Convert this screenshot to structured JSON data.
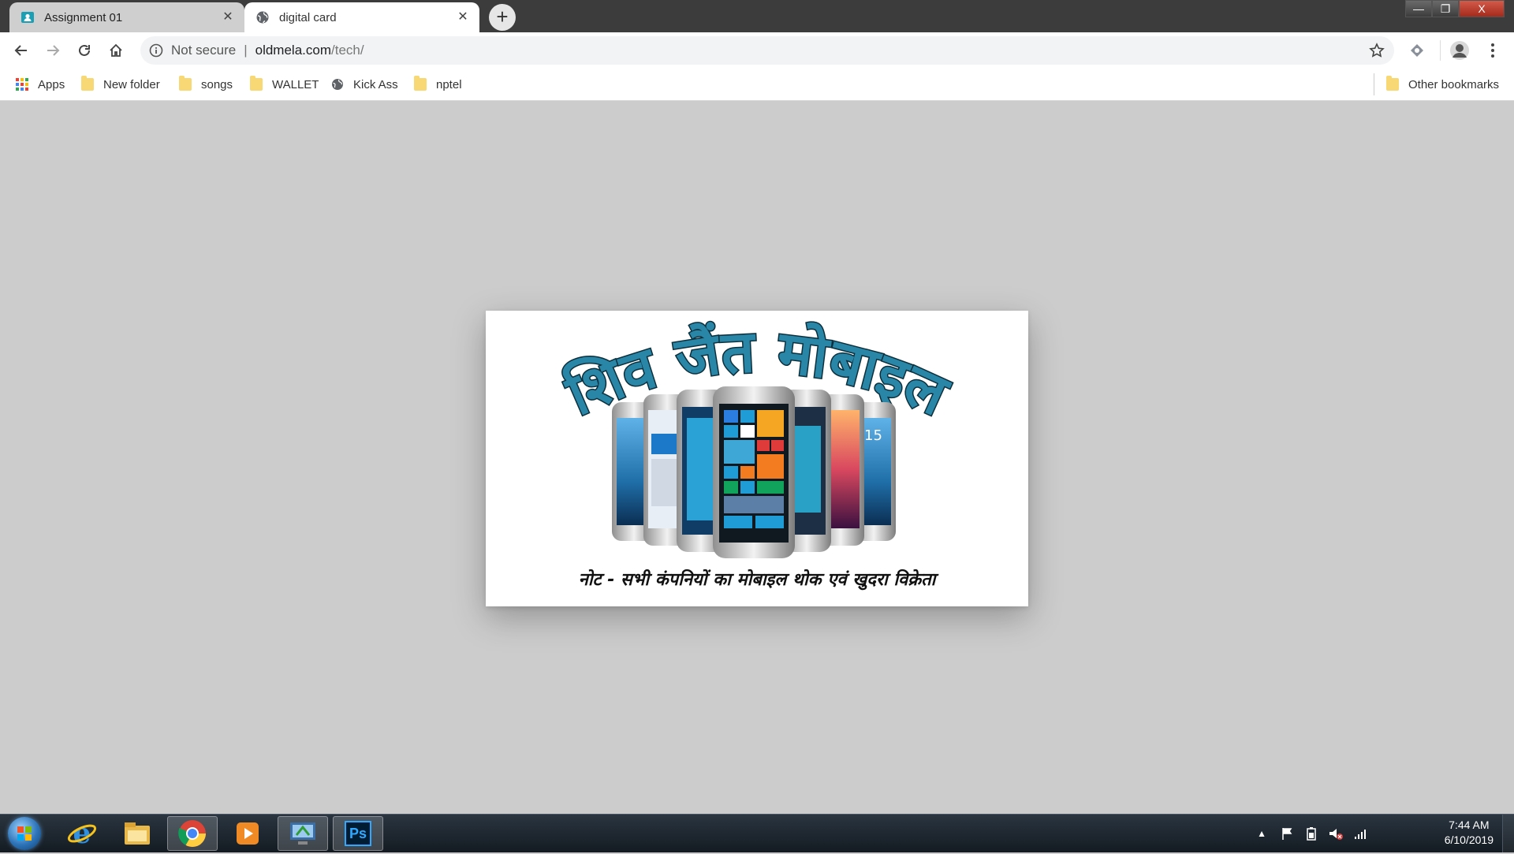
{
  "browser": {
    "tabs": [
      {
        "title": "Assignment 01",
        "icon": "classroom-icon",
        "active": false
      },
      {
        "title": "digital card",
        "icon": "globe-icon",
        "active": true
      }
    ],
    "new_tab_label": "+",
    "window_controls": {
      "minimize": "—",
      "maximize": "❐",
      "close": "X"
    },
    "address": {
      "security_label": "Not secure",
      "separator": "|",
      "domain": "oldmela.com",
      "path": "/tech/"
    },
    "bookmarks": [
      {
        "label": "Apps",
        "icon": "apps-grid-icon"
      },
      {
        "label": "New folder",
        "icon": "folder-icon"
      },
      {
        "label": "songs",
        "icon": "folder-icon"
      },
      {
        "label": "WALLET",
        "icon": "folder-icon"
      },
      {
        "label": "Kick Ass",
        "icon": "globe-icon"
      },
      {
        "label": "nptel",
        "icon": "folder-icon"
      }
    ],
    "other_bookmarks": "Other bookmarks"
  },
  "card": {
    "title": "शिव जैंत मोबाइल",
    "tagline": "नोट - सभी कंपनियों का मोबाइल थोक एवं खुदरा विक्रेता",
    "title_color": "#2a86a6"
  },
  "taskbar": {
    "apps": [
      "internet-explorer-icon",
      "file-explorer-icon",
      "chrome-icon",
      "media-player-icon",
      "system-icon",
      "photoshop-icon"
    ],
    "photoshop_label": "Ps",
    "clock": {
      "time": "7:44 AM",
      "date": "6/10/2019"
    }
  }
}
